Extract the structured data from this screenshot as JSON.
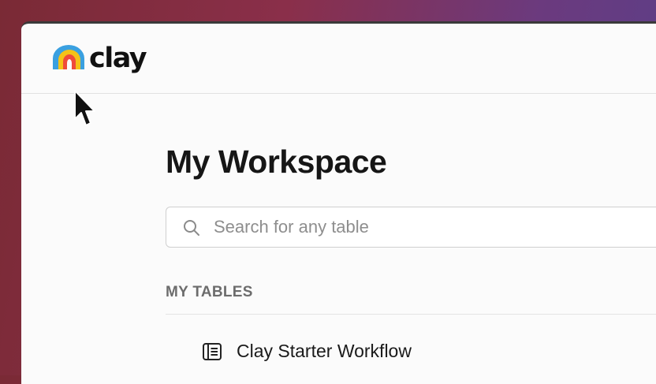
{
  "app": {
    "logo_text": "clay",
    "colors": {
      "background": "#fbfbfb",
      "text": "#161616",
      "muted": "#6c6c6c",
      "border": "#cfcfcf"
    }
  },
  "workspace": {
    "title": "My Workspace"
  },
  "search": {
    "placeholder": "Search for any table",
    "value": ""
  },
  "tables_section": {
    "label": "MY TABLES",
    "items": [
      {
        "name": "Clay Starter Workflow",
        "icon": "table-icon"
      }
    ]
  }
}
